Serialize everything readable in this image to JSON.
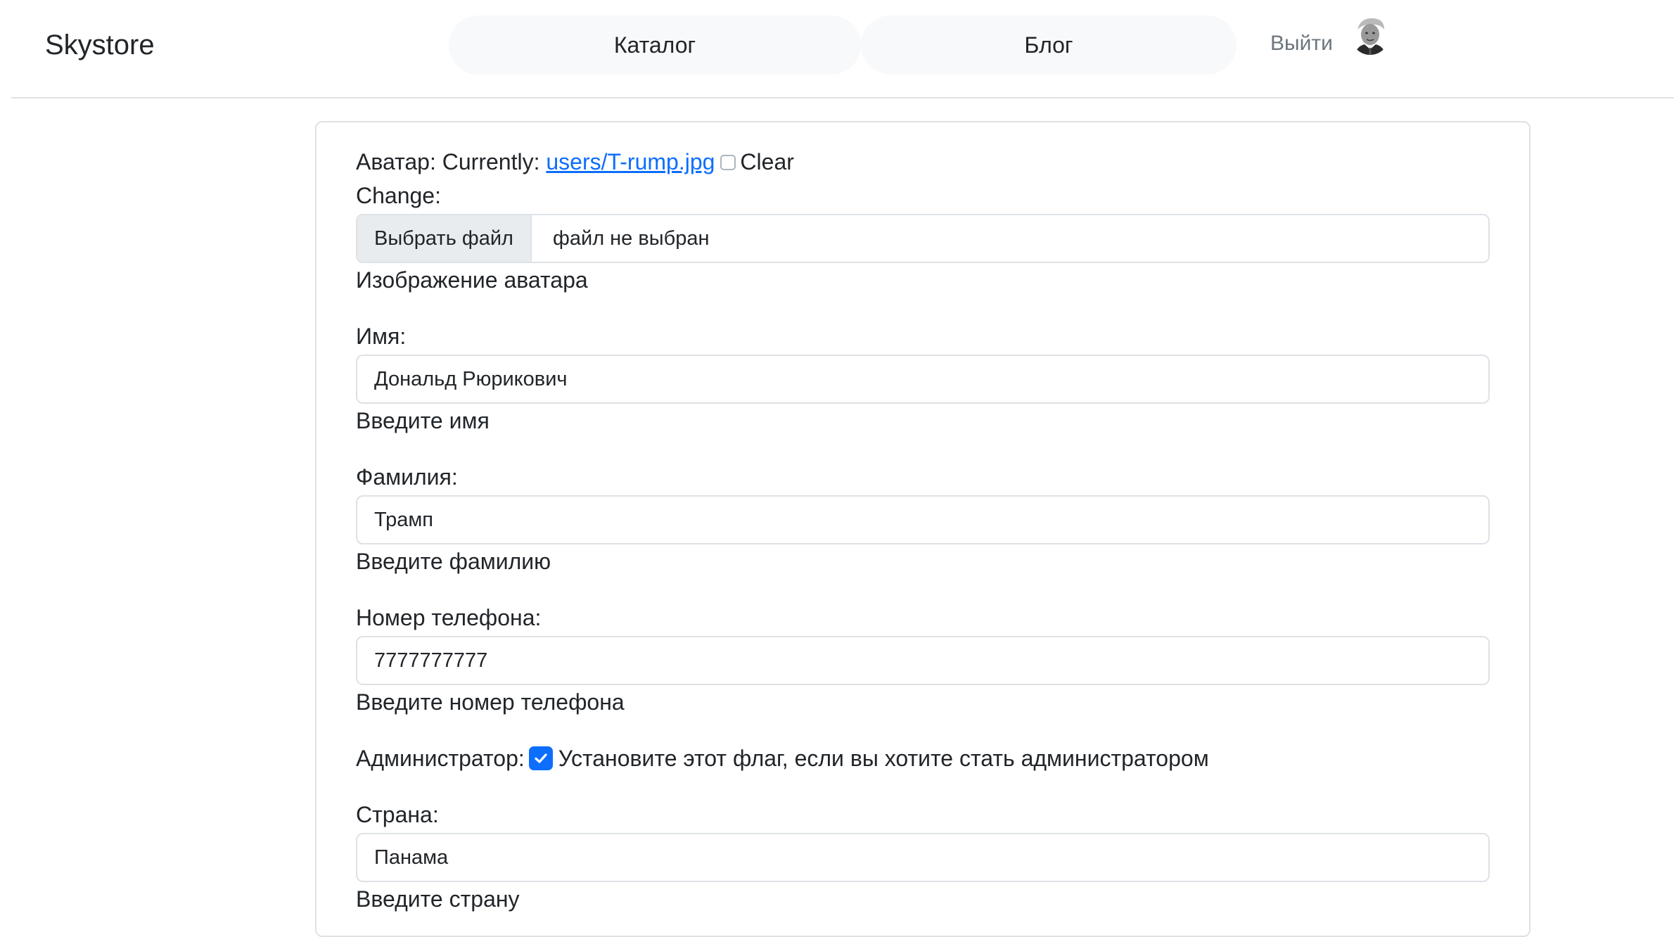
{
  "header": {
    "brand": "Skystore",
    "nav": {
      "catalog": "Каталог",
      "blog": "Блог"
    },
    "logout": "Выйти",
    "avatar_icon": "user-avatar-photo"
  },
  "form": {
    "avatar": {
      "label": "Аватар:",
      "currently_label": "Currently:",
      "current_file": "users/T-rump.jpg",
      "clear_label": "Clear",
      "change_label": "Change:",
      "file_button": "Выбрать файл",
      "file_status": "файл не выбран",
      "help": "Изображение аватара"
    },
    "first_name": {
      "label": "Имя:",
      "value": "Дональд Рюрикович",
      "help": "Введите имя"
    },
    "last_name": {
      "label": "Фамилия:",
      "value": "Трамп",
      "help": "Введите фамилию"
    },
    "phone": {
      "label": "Номер телефона:",
      "value": "7777777777",
      "help": "Введите номер телефона"
    },
    "admin": {
      "label": "Администратор:",
      "checked": true,
      "help": "Установите этот флаг, если вы хотите стать администратором"
    },
    "country": {
      "label": "Страна:",
      "value": "Панама",
      "help": "Введите страну"
    }
  },
  "colors": {
    "accent": "#0d6efd",
    "border": "#dee2e6",
    "nav_bg": "#f8f9fa"
  }
}
